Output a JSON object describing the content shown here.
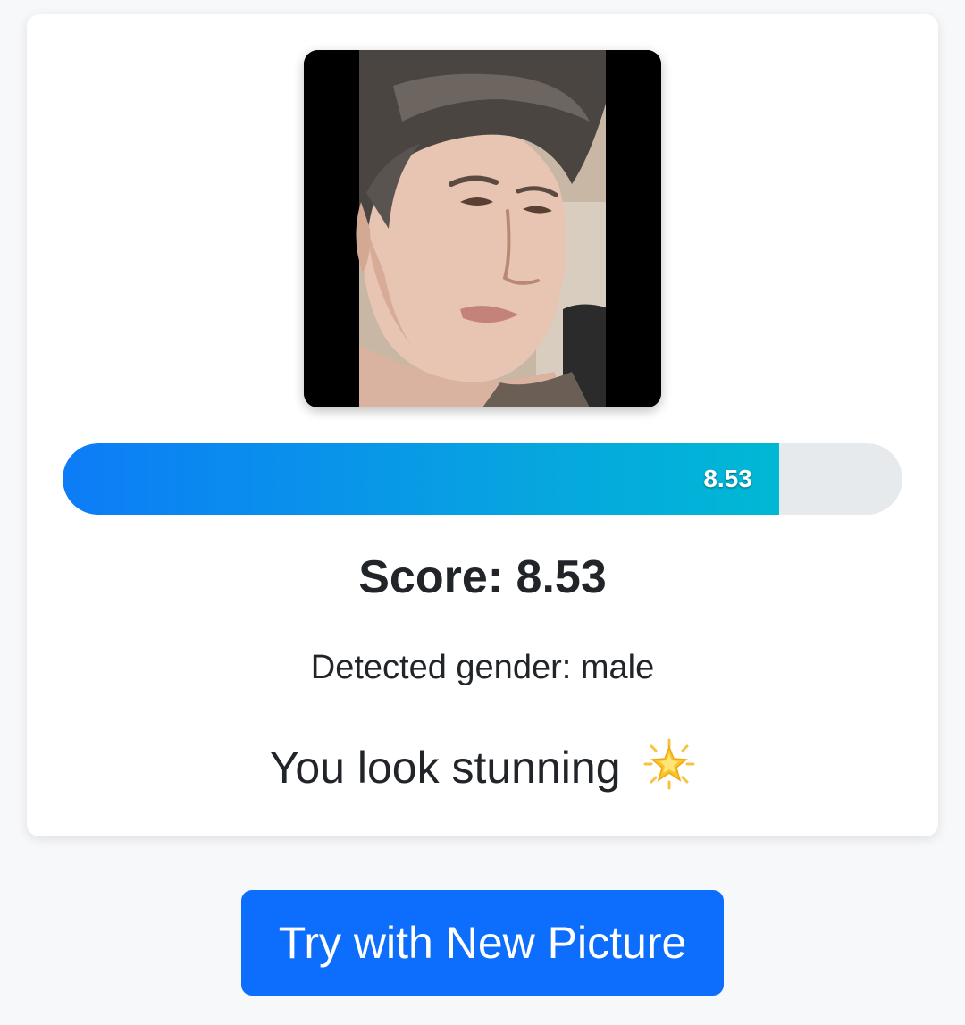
{
  "result": {
    "score_value": 8.53,
    "score_max": 10,
    "bar_label": "8.53",
    "score_text": "Score: 8.53",
    "gender_text": "Detected gender: male",
    "message_text": "You look stunning",
    "message_icon": "glowing-star-icon"
  },
  "actions": {
    "new_picture_label": "Try with New Picture"
  },
  "colors": {
    "accent": "#0d6efd",
    "bar_start": "#0d7cf7",
    "bar_end": "#00b8d4",
    "track": "#e7eaed",
    "background": "#f7f8fa"
  }
}
